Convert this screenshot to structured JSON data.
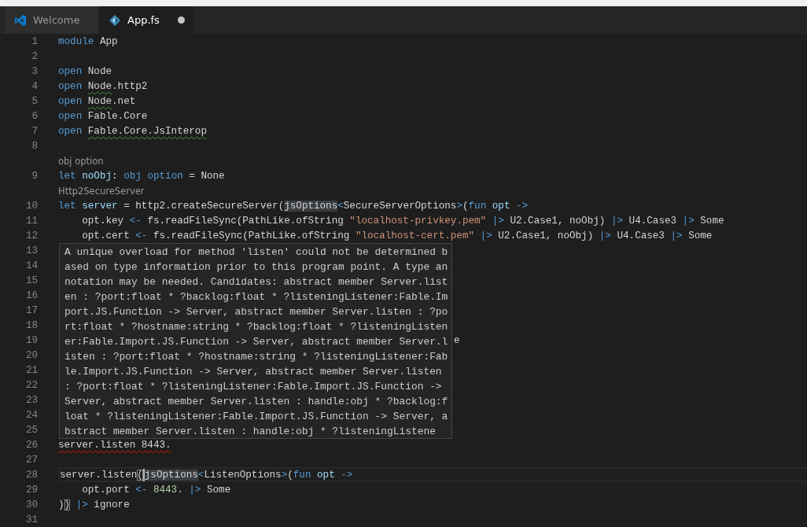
{
  "tabs": [
    {
      "label": "Welcome",
      "selected": false,
      "dirty": false
    },
    {
      "label": "App.fs",
      "selected": true,
      "dirty": true
    }
  ],
  "editor": {
    "lines": [
      {
        "kind": "code",
        "n": "1",
        "tokens": [
          {
            "t": "module",
            "kind": "keyword"
          },
          {
            "t": " App",
            "kind": "plain"
          }
        ]
      },
      {
        "kind": "code",
        "n": "2"
      },
      {
        "kind": "code",
        "n": "3",
        "tokens": [
          {
            "t": "open",
            "kind": "keyword"
          },
          {
            "t": " Node",
            "kind": "plain"
          }
        ]
      },
      {
        "kind": "code",
        "n": "4",
        "tokens": [
          {
            "t": "open ",
            "kind": "keyword"
          },
          {
            "t": "Node",
            "kind": "plain",
            "warning": true
          },
          {
            "t": ".http2",
            "kind": "plain"
          }
        ]
      },
      {
        "kind": "code",
        "n": "5",
        "tokens": [
          {
            "t": "open ",
            "kind": "keyword"
          },
          {
            "t": "Node",
            "kind": "plain",
            "warning": true
          },
          {
            "t": ".net",
            "kind": "plain"
          }
        ]
      },
      {
        "kind": "code",
        "n": "6",
        "tokens": [
          {
            "t": "open",
            "kind": "keyword"
          },
          {
            "t": " Fable.Core",
            "kind": "plain"
          }
        ]
      },
      {
        "kind": "code",
        "n": "7",
        "tokens": [
          {
            "t": "open ",
            "kind": "keyword"
          },
          {
            "t": "Fable.Core.JsInterop",
            "kind": "plain",
            "warning": true
          }
        ]
      },
      {
        "kind": "code",
        "n": "8"
      },
      {
        "kind": "lens",
        "text": "obj option"
      },
      {
        "kind": "code",
        "n": "9",
        "tokens": [
          {
            "t": "let",
            "kind": "keyword"
          },
          {
            "t": " noObj",
            "kind": "variable"
          },
          {
            "t": ": ",
            "kind": "plain"
          },
          {
            "t": "obj option",
            "kind": "keyword"
          },
          {
            "t": " = ",
            "kind": "plain"
          },
          {
            "t": "None",
            "kind": "plain"
          }
        ]
      },
      {
        "kind": "lens",
        "text": "Http2SecureServer"
      },
      {
        "kind": "code",
        "n": "10",
        "tokens": [
          {
            "t": "let",
            "kind": "keyword"
          },
          {
            "t": " server",
            "kind": "variable"
          },
          {
            "t": " = http2.createSecureServer(",
            "kind": "plain"
          },
          {
            "t": "jsOptions",
            "kind": "plain",
            "highlight": true
          },
          {
            "t": "<",
            "kind": "keyword"
          },
          {
            "t": "SecureServerOptions",
            "kind": "plain"
          },
          {
            "t": ">",
            "kind": "keyword"
          },
          {
            "t": "(",
            "kind": "plain"
          },
          {
            "t": "fun",
            "kind": "keyword"
          },
          {
            "t": " opt ",
            "kind": "variable"
          },
          {
            "t": "->",
            "kind": "keyword"
          }
        ]
      },
      {
        "kind": "code",
        "n": "11",
        "tokens": [
          {
            "t": "    opt.key ",
            "kind": "plain"
          },
          {
            "t": "<-",
            "kind": "keyword"
          },
          {
            "t": " fs.readFileSync(PathLike.ofString ",
            "kind": "plain"
          },
          {
            "t": "\"localhost-privkey.pem\"",
            "kind": "string"
          },
          {
            "t": " |>",
            "kind": "keyword"
          },
          {
            "t": " U2.Case1, noObj) ",
            "kind": "plain"
          },
          {
            "t": "|>",
            "kind": "keyword"
          },
          {
            "t": " U4.Case3 ",
            "kind": "plain"
          },
          {
            "t": "|>",
            "kind": "keyword"
          },
          {
            "t": " Some",
            "kind": "plain"
          }
        ]
      },
      {
        "kind": "code",
        "n": "12",
        "tokens": [
          {
            "t": "    opt.cert ",
            "kind": "plain"
          },
          {
            "t": "<-",
            "kind": "keyword"
          },
          {
            "t": " fs.readFileSync(PathLike.ofString ",
            "kind": "plain"
          },
          {
            "t": "\"localhost-cert.pem\"",
            "kind": "string"
          },
          {
            "t": " |>",
            "kind": "keyword"
          },
          {
            "t": " U2.Case1, noObj) ",
            "kind": "plain"
          },
          {
            "t": "|>",
            "kind": "keyword"
          },
          {
            "t": " U4.Case3 ",
            "kind": "plain"
          },
          {
            "t": "|>",
            "kind": "keyword"
          },
          {
            "t": " Some",
            "kind": "plain"
          }
        ]
      },
      {
        "kind": "code",
        "n": "13"
      },
      {
        "kind": "code",
        "n": "14"
      },
      {
        "kind": "code",
        "n": "15"
      },
      {
        "kind": "code",
        "n": "16"
      },
      {
        "kind": "code",
        "n": "17"
      },
      {
        "kind": "code",
        "n": "18"
      },
      {
        "kind": "code",
        "n": "19",
        "peek": "e"
      },
      {
        "kind": "code",
        "n": "20"
      },
      {
        "kind": "code",
        "n": "21"
      },
      {
        "kind": "code",
        "n": "22"
      },
      {
        "kind": "code",
        "n": "23"
      },
      {
        "kind": "code",
        "n": "24"
      },
      {
        "kind": "code",
        "n": "25"
      },
      {
        "kind": "code",
        "n": "26",
        "tokens": [
          {
            "t": "server.listen 8443.",
            "kind": "plain",
            "error": true
          }
        ]
      },
      {
        "kind": "code",
        "n": "27"
      },
      {
        "kind": "code",
        "n": "28",
        "current": true,
        "tokens": [
          {
            "t": "server.listen",
            "kind": "plain"
          },
          {
            "t": "(",
            "kind": "plain",
            "bracket": true
          },
          {
            "t": "jsOptions",
            "kind": "plain",
            "highlight": true
          },
          {
            "t": "<",
            "kind": "keyword"
          },
          {
            "t": "ListenOptions",
            "kind": "plain"
          },
          {
            "t": ">",
            "kind": "keyword"
          },
          {
            "t": "(",
            "kind": "plain"
          },
          {
            "t": "fun",
            "kind": "keyword"
          },
          {
            "t": " opt ",
            "kind": "variable"
          },
          {
            "t": "->",
            "kind": "keyword"
          }
        ]
      },
      {
        "kind": "code",
        "n": "29",
        "tokens": [
          {
            "t": "    opt.port ",
            "kind": "plain"
          },
          {
            "t": "<-",
            "kind": "keyword"
          },
          {
            "t": " 8443.",
            "kind": "number"
          },
          {
            "t": " |>",
            "kind": "keyword"
          },
          {
            "t": " Some",
            "kind": "plain"
          }
        ]
      },
      {
        "kind": "code",
        "n": "30",
        "tokens": [
          {
            "t": ")",
            "kind": "plain"
          },
          {
            "t": ")",
            "kind": "plain",
            "bracket": true
          },
          {
            "t": " |>",
            "kind": "keyword"
          },
          {
            "t": " ignore",
            "kind": "plain"
          }
        ]
      },
      {
        "kind": "code",
        "n": "31"
      }
    ],
    "hover": {
      "text": "A unique overload for method 'listen' could not be determined based on type information prior to this program point. A type annotation may be needed. Candidates: abstract member Server.listen : ?port:float * ?backlog:float * ?listeningListener:Fable.Import.JS.Function -> Server, abstract member Server.listen : ?port:float * ?hostname:string * ?backlog:float * ?listeningListener:Fable.Import.JS.Function -> Server, abstract member Server.listen : ?port:float * ?hostname:string * ?listeningListener:Fable.Import.JS.Function -> Server, abstract member Server.listen : ?port:float * ?listeningListener:Fable.Import.JS.Function -> Server, abstract member Server.listen : handle:obj * ?backlog:float * ?listeningListener:Fable.Import.JS.Function -> Server, abstract member Server.listen : handle:obj * ?listeningListene"
    }
  }
}
